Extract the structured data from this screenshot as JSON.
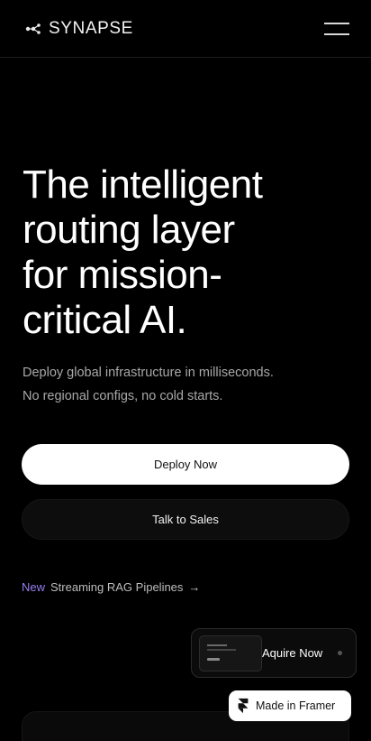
{
  "header": {
    "brand": "SYNAPSE",
    "logo_icon": "synapse-logo-icon",
    "menu_icon": "hamburger-menu-icon"
  },
  "hero": {
    "title_lines": [
      "The intelligent",
      "routing layer",
      "for mission-",
      "critical AI."
    ],
    "subtitle_lines": [
      "Deploy global infrastructure in milliseconds.",
      "No regional configs, no cold starts."
    ]
  },
  "cta": {
    "primary_label": "Deploy Now",
    "secondary_label": "Talk to Sales"
  },
  "announcement": {
    "badge": "New",
    "text": "Streaming RAG Pipelines",
    "arrow": "→"
  },
  "acquire": {
    "label": "Aquire Now"
  },
  "framer_badge": {
    "label": "Made in Framer",
    "icon": "framer-logo-icon"
  },
  "colors": {
    "background": "#000000",
    "accent_purple": "#9a7ef0",
    "primary_button": "#ffffff",
    "muted_text": "#a8a8a8"
  }
}
